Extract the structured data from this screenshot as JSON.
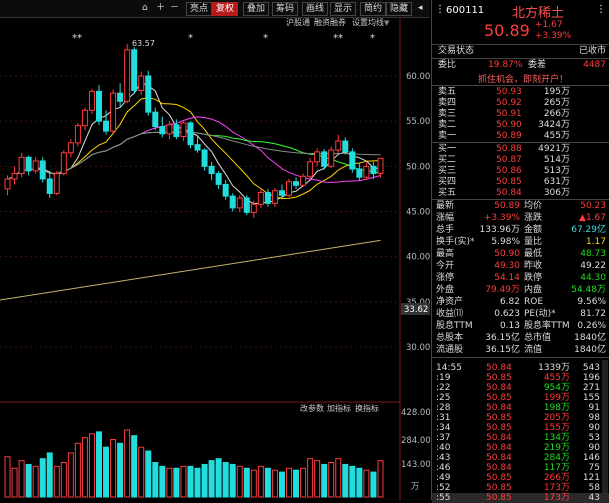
{
  "toolbar": {
    "items": [
      "亮点",
      "复权",
      "叠加",
      "筹码",
      "画线",
      "显示",
      "简约",
      "隐藏"
    ],
    "active_index": 1
  },
  "indicator_tabs": [
    "沪股通",
    "融资融券",
    "设置均线"
  ],
  "price_axis": [
    "60.00",
    "55.00",
    "50.00",
    "45.00",
    "40.00",
    "35.00",
    "30.00"
  ],
  "price_marker": "33.62",
  "high_label": "63.57",
  "event_marks": [
    "**",
    "*",
    "*",
    "**",
    "*"
  ],
  "vol_bar_tabs": [
    "改参数",
    "加指标",
    "换指标"
  ],
  "vol_axis": [
    "428.00",
    "284.00",
    "143.00",
    "万"
  ],
  "stock": {
    "code": "600111",
    "name": "北方稀土",
    "price": "50.89",
    "change": "+1.67",
    "pct": "+3.39%"
  },
  "trade_status": {
    "label": "交易状态",
    "value": "已收市"
  },
  "weibi": {
    "label": "委比",
    "value": "19.87%",
    "label2": "委差",
    "value2": "4487"
  },
  "banner": "抓住机会，即刻开户！",
  "asks": [
    {
      "label": "卖五",
      "price": "50.93",
      "vol": "195万"
    },
    {
      "label": "卖四",
      "price": "50.92",
      "vol": "265万"
    },
    {
      "label": "卖三",
      "price": "50.91",
      "vol": "266万"
    },
    {
      "label": "卖二",
      "price": "50.90",
      "vol": "3424万"
    },
    {
      "label": "卖一",
      "price": "50.89",
      "vol": "455万"
    }
  ],
  "bids": [
    {
      "label": "买一",
      "price": "50.88",
      "vol": "4921万"
    },
    {
      "label": "买二",
      "price": "50.87",
      "vol": "514万"
    },
    {
      "label": "买三",
      "price": "50.86",
      "vol": "513万"
    },
    {
      "label": "买四",
      "price": "50.85",
      "vol": "631万"
    },
    {
      "label": "买五",
      "price": "50.84",
      "vol": "306万"
    }
  ],
  "quotes": [
    {
      "l1": "最新",
      "v1": "50.89",
      "c1": "red",
      "l2": "均价",
      "v2": "50.23",
      "c2": "red"
    },
    {
      "l1": "涨幅",
      "v1": "+3.39%",
      "c1": "red",
      "l2": "涨跌",
      "v2": "▲1.67",
      "c2": "red"
    },
    {
      "l1": "总手",
      "v1": "133.96万",
      "c1": "white",
      "l2": "金额",
      "v2": "67.29亿",
      "c2": "cyan"
    },
    {
      "l1": "换手(实)*",
      "v1": "5.98%",
      "c1": "white",
      "l2": "量比",
      "v2": "1.17",
      "c2": "yellow"
    },
    {
      "l1": "最高",
      "v1": "50.90",
      "c1": "red",
      "l2": "最低",
      "v2": "48.73",
      "c2": "green"
    },
    {
      "l1": "今开",
      "v1": "49.30",
      "c1": "red",
      "l2": "昨收",
      "v2": "49.22",
      "c2": "white"
    },
    {
      "l1": "涨停",
      "v1": "54.14",
      "c1": "red",
      "l2": "跌停",
      "v2": "44.30",
      "c2": "green"
    },
    {
      "l1": "外盘",
      "v1": "79.49万",
      "c1": "red",
      "l2": "内盘",
      "v2": "54.48万",
      "c2": "green"
    },
    {
      "l1": "净资产",
      "v1": "6.82",
      "c1": "white",
      "l2": "ROE",
      "v2": "9.56%",
      "c2": "white"
    },
    {
      "l1": "收益⑾",
      "v1": "0.623",
      "c1": "white",
      "l2": "PE(动)*",
      "v2": "81.72",
      "c2": "white"
    },
    {
      "l1": "股息TTM",
      "v1": "0.13",
      "c1": "white",
      "l2": "股息率TTM",
      "v2": "0.26%",
      "c2": "white"
    },
    {
      "l1": "总股本",
      "v1": "36.15亿",
      "c1": "white",
      "l2": "总市值",
      "v2": "1840亿",
      "c2": "white"
    },
    {
      "l1": "流通股",
      "v1": "36.15亿",
      "c1": "white",
      "l2": "流值",
      "v2": "1840亿",
      "c2": "white"
    }
  ],
  "ticks": [
    {
      "t": "14:55",
      "p": "50.84",
      "pc": "red",
      "v": "1339万",
      "vc": "white",
      "n": "543"
    },
    {
      "t": ":19",
      "p": "50.85",
      "pc": "red",
      "v": "455万",
      "vc": "red",
      "n": "196"
    },
    {
      "t": ":22",
      "p": "50.84",
      "pc": "red",
      "v": "954万",
      "vc": "green",
      "n": "271"
    },
    {
      "t": ":25",
      "p": "50.85",
      "pc": "red",
      "v": "199万",
      "vc": "red",
      "n": "155"
    },
    {
      "t": ":28",
      "p": "50.84",
      "pc": "red",
      "v": "198万",
      "vc": "green",
      "n": "91"
    },
    {
      "t": ":31",
      "p": "50.85",
      "pc": "red",
      "v": "205万",
      "vc": "red",
      "n": "98"
    },
    {
      "t": ":34",
      "p": "50.85",
      "pc": "red",
      "v": "155万",
      "vc": "red",
      "n": "90"
    },
    {
      "t": ":37",
      "p": "50.84",
      "pc": "red",
      "v": "134万",
      "vc": "green",
      "n": "53"
    },
    {
      "t": ":40",
      "p": "50.84",
      "pc": "red",
      "v": "219万",
      "vc": "green",
      "n": "90"
    },
    {
      "t": ":43",
      "p": "50.84",
      "pc": "red",
      "v": "284万",
      "vc": "green",
      "n": "146"
    },
    {
      "t": ":46",
      "p": "50.84",
      "pc": "red",
      "v": "117万",
      "vc": "green",
      "n": "75"
    },
    {
      "t": ":49",
      "p": "50.85",
      "pc": "red",
      "v": "266万",
      "vc": "red",
      "n": "121"
    },
    {
      "t": ":52",
      "p": "50.85",
      "pc": "red",
      "v": "173万",
      "vc": "red",
      "n": "58"
    },
    {
      "t": ":55",
      "p": "50.85",
      "pc": "red",
      "v": "173万",
      "vc": "red",
      "n": "43"
    }
  ],
  "colors": {
    "up": "#ff3b3b",
    "down": "#22dddd",
    "ma5": "#dddddd",
    "ma10": "#ffd700",
    "ma20": "#ff44ff",
    "ma30": "#33ff33",
    "ma60": "#888888",
    "ma250": "#c8b070"
  },
  "candles": [
    [
      47.5,
      49.0,
      46.8,
      48.6
    ],
    [
      48.6,
      50.0,
      48.0,
      49.2
    ],
    [
      49.2,
      51.5,
      48.8,
      51.0
    ],
    [
      51.0,
      51.2,
      49.0,
      49.5
    ],
    [
      49.5,
      51.0,
      49.2,
      50.6
    ],
    [
      50.6,
      51.0,
      48.2,
      48.6
    ],
    [
      48.6,
      49.5,
      46.5,
      47.0
    ],
    [
      47.0,
      49.5,
      46.8,
      49.2
    ],
    [
      49.2,
      51.8,
      49.0,
      51.5
    ],
    [
      51.5,
      53.0,
      51.0,
      52.6
    ],
    [
      52.6,
      54.8,
      52.2,
      54.5
    ],
    [
      54.5,
      56.5,
      54.0,
      56.2
    ],
    [
      56.2,
      58.6,
      55.8,
      58.3
    ],
    [
      58.3,
      59.0,
      54.6,
      55.0
    ],
    [
      55.0,
      56.2,
      53.5,
      53.9
    ],
    [
      53.9,
      58.5,
      53.6,
      58.1
    ],
    [
      58.1,
      59.2,
      56.5,
      57.2
    ],
    [
      57.2,
      63.57,
      57.0,
      62.9
    ],
    [
      62.9,
      63.2,
      58.0,
      58.4
    ],
    [
      58.4,
      60.5,
      57.9,
      60.0
    ],
    [
      60.0,
      60.6,
      55.6,
      56.0
    ],
    [
      56.0,
      56.5,
      54.0,
      54.4
    ],
    [
      54.4,
      55.5,
      53.2,
      53.6
    ],
    [
      53.6,
      55.0,
      53.0,
      54.6
    ],
    [
      54.6,
      55.2,
      53.0,
      53.3
    ],
    [
      53.3,
      55.0,
      52.8,
      54.8
    ],
    [
      54.8,
      55.0,
      52.0,
      52.4
    ],
    [
      52.4,
      53.5,
      51.5,
      51.8
    ],
    [
      51.8,
      52.0,
      49.5,
      50.0
    ],
    [
      50.0,
      50.5,
      48.5,
      49.2
    ],
    [
      49.2,
      49.5,
      47.5,
      48.0
    ],
    [
      48.0,
      48.5,
      46.3,
      46.7
    ],
    [
      46.7,
      47.0,
      45.0,
      45.4
    ],
    [
      45.4,
      46.8,
      44.9,
      46.5
    ],
    [
      46.5,
      46.8,
      44.6,
      44.9
    ],
    [
      44.9,
      46.2,
      44.3,
      45.8
    ],
    [
      45.8,
      47.4,
      45.4,
      47.1
    ],
    [
      47.1,
      47.5,
      45.5,
      45.9
    ],
    [
      45.9,
      47.6,
      45.5,
      47.3
    ],
    [
      47.3,
      48.0,
      46.5,
      46.8
    ],
    [
      46.8,
      48.6,
      46.6,
      48.3
    ],
    [
      48.3,
      48.8,
      47.5,
      47.9
    ],
    [
      47.9,
      49.2,
      47.7,
      48.9
    ],
    [
      48.9,
      50.9,
      48.6,
      50.5
    ],
    [
      50.5,
      52.0,
      50.0,
      51.6
    ],
    [
      51.6,
      51.9,
      49.6,
      50.0
    ],
    [
      50.0,
      52.2,
      49.8,
      51.8
    ],
    [
      51.8,
      53.5,
      51.5,
      52.8
    ],
    [
      52.8,
      53.2,
      51.3,
      51.6
    ],
    [
      51.6,
      52.0,
      49.3,
      49.7
    ],
    [
      49.7,
      50.3,
      48.4,
      48.8
    ],
    [
      48.8,
      50.4,
      48.5,
      50.0
    ],
    [
      50.0,
      50.5,
      48.6,
      49.2
    ],
    [
      49.22,
      50.9,
      48.73,
      50.89
    ]
  ],
  "volumes": [
    210,
    150,
    190,
    170,
    160,
    200,
    230,
    160,
    180,
    230,
    280,
    310,
    330,
    340,
    260,
    300,
    280,
    350,
    320,
    260,
    240,
    180,
    160,
    150,
    150,
    160,
    160,
    150,
    170,
    190,
    200,
    180,
    170,
    160,
    150,
    140,
    160,
    150,
    140,
    130,
    150,
    140,
    150,
    200,
    190,
    170,
    180,
    200,
    170,
    160,
    150,
    140,
    130,
    190
  ]
}
